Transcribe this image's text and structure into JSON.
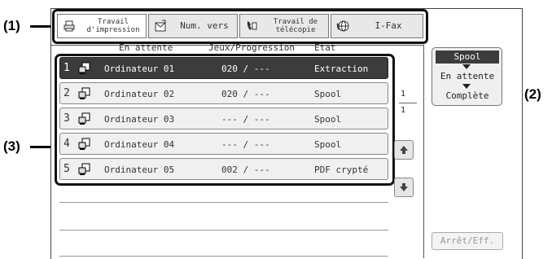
{
  "callouts": {
    "tabs": "(1)",
    "spool": "(2)",
    "list": "(3)"
  },
  "tabs": [
    {
      "label": "Travail\nd'impression",
      "icon": "printer-icon",
      "active": true
    },
    {
      "label": "Num. vers",
      "icon": "scan-icon",
      "active": false
    },
    {
      "label": "Travail de\ntélécopie",
      "icon": "fax-icon",
      "active": false
    },
    {
      "label": "I-Fax",
      "icon": "internet-fax-icon",
      "active": false
    }
  ],
  "columns": {
    "waiting": "En attente",
    "sets": "Jeux/Progression",
    "state": "Etat"
  },
  "jobs": [
    {
      "num": "1",
      "name": "Ordinateur 01",
      "progress": "020 / ---",
      "status": "Extraction",
      "selected": true
    },
    {
      "num": "2",
      "name": "Ordinateur 02",
      "progress": "020 / ---",
      "status": "Spool",
      "selected": false
    },
    {
      "num": "3",
      "name": "Ordinateur 03",
      "progress": "--- / ---",
      "status": "Spool",
      "selected": false
    },
    {
      "num": "4",
      "name": "Ordinateur 04",
      "progress": "--- / ---",
      "status": "Spool",
      "selected": false
    },
    {
      "num": "5",
      "name": "Ordinateur 05",
      "progress": "002 / ---",
      "status": "PDF crypté",
      "selected": false
    }
  ],
  "pager": {
    "current": "1",
    "total": "1"
  },
  "spool_selector": {
    "options": [
      "Spool",
      "En attente",
      "Complète"
    ],
    "selected": "Spool"
  },
  "stop_button": "Arrêt/Eff.",
  "colors": {
    "selected_row": "#3c3c3c",
    "frame": "#111111"
  }
}
